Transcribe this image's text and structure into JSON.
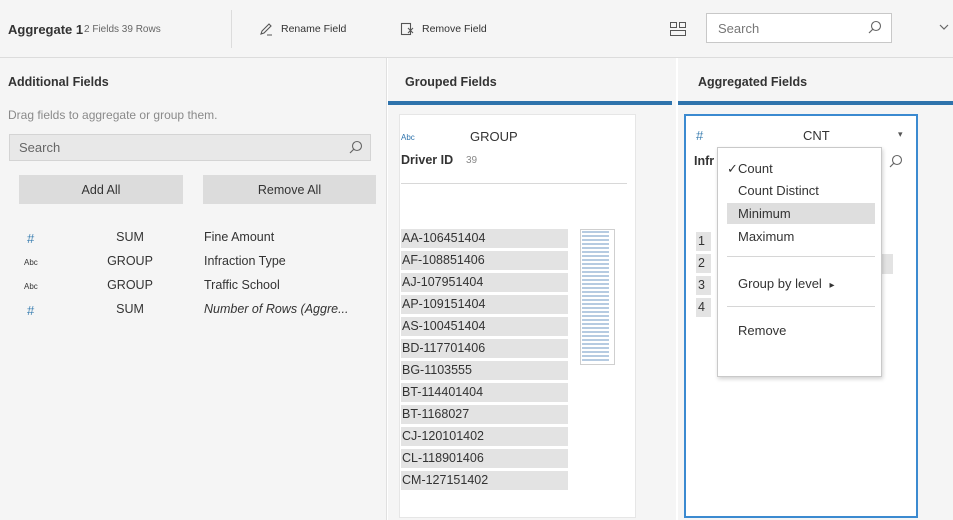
{
  "toolbar": {
    "title": "Aggregate 1",
    "meta": "2 Fields  39 Rows",
    "rename_label": "Rename Field",
    "remove_label": "Remove Field",
    "search_placeholder": "Search"
  },
  "additional": {
    "title": "Additional Fields",
    "hint": "Drag fields to aggregate or group them.",
    "search_placeholder": "Search",
    "add_all": "Add All",
    "remove_all": "Remove All",
    "fields": [
      {
        "type": "number",
        "type_glyph": "#",
        "agg": "SUM",
        "name": "Fine Amount"
      },
      {
        "type": "string",
        "type_glyph": "Abc",
        "agg": "GROUP",
        "name": "Infraction Type"
      },
      {
        "type": "string",
        "type_glyph": "Abc",
        "agg": "GROUP",
        "name": "Traffic School"
      },
      {
        "type": "number",
        "type_glyph": "#",
        "agg": "SUM",
        "name": "Number of Rows (Aggre..."
      }
    ]
  },
  "grouped": {
    "title": "Grouped Fields",
    "type_glyph": "Abc",
    "agg": "GROUP",
    "field_name": "Driver ID",
    "field_count": "39",
    "values": [
      "AA-106451404",
      "AF-108851406",
      "AJ-107951404",
      "AP-109151404",
      "AS-100451404",
      "BD-117701406",
      "BG-1103555",
      "BT-114401404",
      "BT-1168027",
      "CJ-120101402",
      "CL-118901406",
      "CM-127151402"
    ]
  },
  "aggregated": {
    "title": "Aggregated Fields",
    "type_glyph": "#",
    "agg": "CNT",
    "caret": "▾",
    "field_name_partial": "Infr",
    "values": [
      "1",
      "2",
      "3",
      "4"
    ]
  },
  "menu": {
    "checkmark": "✓",
    "items": [
      "Count",
      "Count Distinct",
      "Minimum",
      "Maximum"
    ],
    "selected": "Count",
    "highlighted": "Minimum",
    "group_by": "Group by level",
    "submenu_arrow": "▸",
    "remove": "Remove"
  },
  "colors": {
    "accent_blue": "#2e73ac",
    "selection_border": "#3b8ad0",
    "panel_bg": "#f5f5f5",
    "value_bg": "#e3e3e3"
  }
}
